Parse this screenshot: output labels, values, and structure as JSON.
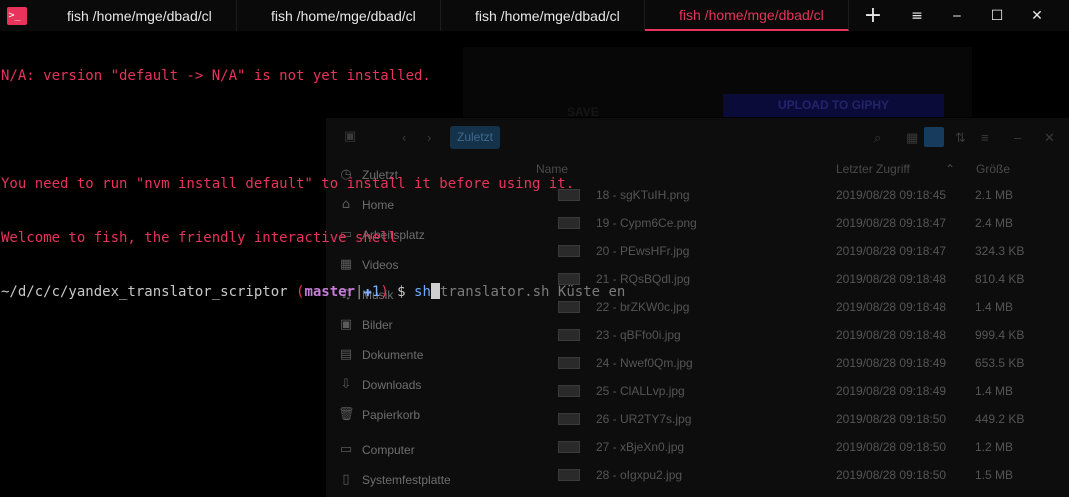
{
  "app": {
    "icon": ">_"
  },
  "tabs": [
    {
      "label": "fish /home/mge/dbad/cl",
      "active": false
    },
    {
      "label": "fish /home/mge/dbad/cl",
      "active": false
    },
    {
      "label": "fish /home/mge/dbad/cl",
      "active": false
    },
    {
      "label": "fish /home/mge/dbad/cl",
      "active": true
    }
  ],
  "window_controls": {
    "add": "+",
    "menu": "≡",
    "minimize": "‒",
    "maximize": "☐",
    "close": "✕"
  },
  "terminal": {
    "line1": "N/A: version \"default -> N/A\" is not yet installed.",
    "line2": "",
    "line3": "You need to run \"nvm install default\" to install it before using it.",
    "line4": "Welcome to fish, the friendly interactive shell",
    "prompt_path": "~/d/c/c/yandex_translator_scriptor",
    "prompt_open": " (",
    "prompt_branch": "master",
    "prompt_sep": "|",
    "prompt_plus": "✚1",
    "prompt_close": ")",
    "prompt_dollar": " $ ",
    "command": "sh",
    "autosuggest": "translator.sh Küste en"
  },
  "background_giphy": {
    "upload_label": "UPLOAD TO GIPHY",
    "left_label": "SAVE"
  },
  "background_filemanager": {
    "breadcrumb": "Zuletzt",
    "columns": {
      "name": "Name",
      "date": "Letzter Zugriff",
      "size": "Größe"
    },
    "sidebar": [
      {
        "label": "Zuletzt",
        "icon": "◷",
        "selected": true
      },
      {
        "label": "Home",
        "icon": "⌂",
        "selected": false
      },
      {
        "label": "Arbeitsplatz",
        "icon": "▭",
        "selected": false
      },
      {
        "label": "Videos",
        "icon": "▦",
        "selected": false
      },
      {
        "label": "Musik",
        "icon": "♫",
        "selected": false
      },
      {
        "label": "Bilder",
        "icon": "▣",
        "selected": false
      },
      {
        "label": "Dokumente",
        "icon": "▤",
        "selected": false
      },
      {
        "label": "Downloads",
        "icon": "⇩",
        "selected": false
      },
      {
        "label": "Papierkorb",
        "icon": "🗑",
        "selected": false
      },
      {
        "label": "Computer",
        "icon": "▭",
        "selected": false
      },
      {
        "label": "Systemfestplatte",
        "icon": "▯",
        "selected": false
      }
    ],
    "files": [
      {
        "name": "18 - sgKTuIH.png",
        "date": "2019/08/28 09:18:45",
        "size": "2.1 MB"
      },
      {
        "name": "19 - Cypm6Ce.png",
        "date": "2019/08/28 09:18:47",
        "size": "2.4 MB"
      },
      {
        "name": "20 - PEwsHFr.jpg",
        "date": "2019/08/28 09:18:47",
        "size": "324.3 KB"
      },
      {
        "name": "21 - RQsBQdl.jpg",
        "date": "2019/08/28 09:18:48",
        "size": "810.4 KB"
      },
      {
        "name": "22 - brZKW0c.jpg",
        "date": "2019/08/28 09:18:48",
        "size": "1.4 MB"
      },
      {
        "name": "23 - qBFfo0i.jpg",
        "date": "2019/08/28 09:18:48",
        "size": "999.4 KB"
      },
      {
        "name": "24 - Nwef0Qm.jpg",
        "date": "2019/08/28 09:18:49",
        "size": "653.5 KB"
      },
      {
        "name": "25 - ClALLvp.jpg",
        "date": "2019/08/28 09:18:49",
        "size": "1.4 MB"
      },
      {
        "name": "26 - UR2TY7s.jpg",
        "date": "2019/08/28 09:18:50",
        "size": "449.2 KB"
      },
      {
        "name": "27 - xBjeXn0.jpg",
        "date": "2019/08/28 09:18:50",
        "size": "1.2 MB"
      },
      {
        "name": "28 - oIgxpu2.jpg",
        "date": "2019/08/28 09:18:50",
        "size": "1.5 MB"
      }
    ]
  },
  "colors": {
    "accent": "#e8335a",
    "branch": "#c77dd8",
    "command": "#6fa8ff"
  }
}
